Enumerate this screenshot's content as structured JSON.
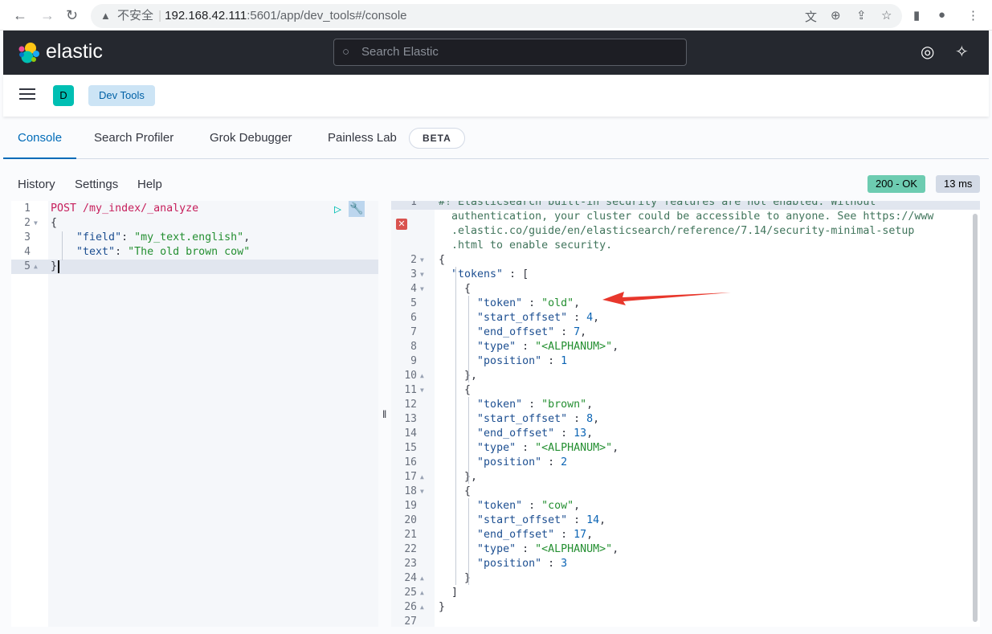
{
  "browser": {
    "security_label": "不安全",
    "url_host": "192.168.42.111",
    "url_path": ":5601/app/dev_tools#/console"
  },
  "header": {
    "brand": "elastic",
    "search_placeholder": "Search Elastic"
  },
  "breadcrumb": {
    "avatar": "D",
    "item": "Dev Tools"
  },
  "tabs": [
    {
      "label": "Console",
      "active": true
    },
    {
      "label": "Search Profiler"
    },
    {
      "label": "Grok Debugger"
    },
    {
      "label": "Painless Lab"
    }
  ],
  "beta_badge": "BETA",
  "toolbar": {
    "history": "History",
    "settings": "Settings",
    "help": "Help"
  },
  "response_status": {
    "status": "200 - OK",
    "status_color": "#6dccb1",
    "time": "13 ms"
  },
  "request_lines": [
    [
      [
        "m",
        "POST"
      ],
      [
        "p",
        " "
      ],
      [
        "u",
        "/my_index/_analyze"
      ]
    ],
    [
      [
        "p",
        "{"
      ]
    ],
    [
      [
        "p",
        "    "
      ],
      [
        "k",
        "\"field\""
      ],
      [
        "p",
        ": "
      ],
      [
        "s",
        "\"my_text.english\""
      ],
      [
        "p",
        ","
      ]
    ],
    [
      [
        "p",
        "    "
      ],
      [
        "k",
        "\"text\""
      ],
      [
        "p",
        ": "
      ],
      [
        "s",
        "\"The old brown cow\""
      ]
    ],
    [
      [
        "p",
        "}"
      ]
    ]
  ],
  "response_comment": [
    "#! Elasticsearch built-in security features are not enabled. Without",
    "  authentication, your cluster could be accessible to anyone. See https://www",
    "  .elastic.co/guide/en/elasticsearch/reference/7.14/security-minimal-setup",
    "  .html to enable security."
  ],
  "response_lines": [
    [
      [
        "p",
        "{"
      ]
    ],
    [
      [
        "p",
        "  "
      ],
      [
        "k",
        "\"tokens\""
      ],
      [
        "p",
        " : ["
      ]
    ],
    [
      [
        "p",
        "    {"
      ]
    ],
    [
      [
        "p",
        "      "
      ],
      [
        "k",
        "\"token\""
      ],
      [
        "p",
        " : "
      ],
      [
        "s",
        "\"old\""
      ],
      [
        "p",
        ","
      ]
    ],
    [
      [
        "p",
        "      "
      ],
      [
        "k",
        "\"start_offset\""
      ],
      [
        "p",
        " : "
      ],
      [
        "n",
        "4"
      ],
      [
        "p",
        ","
      ]
    ],
    [
      [
        "p",
        "      "
      ],
      [
        "k",
        "\"end_offset\""
      ],
      [
        "p",
        " : "
      ],
      [
        "n",
        "7"
      ],
      [
        "p",
        ","
      ]
    ],
    [
      [
        "p",
        "      "
      ],
      [
        "k",
        "\"type\""
      ],
      [
        "p",
        " : "
      ],
      [
        "s",
        "\"<ALPHANUM>\""
      ],
      [
        "p",
        ","
      ]
    ],
    [
      [
        "p",
        "      "
      ],
      [
        "k",
        "\"position\""
      ],
      [
        "p",
        " : "
      ],
      [
        "n",
        "1"
      ]
    ],
    [
      [
        "p",
        "    },"
      ]
    ],
    [
      [
        "p",
        "    {"
      ]
    ],
    [
      [
        "p",
        "      "
      ],
      [
        "k",
        "\"token\""
      ],
      [
        "p",
        " : "
      ],
      [
        "s",
        "\"brown\""
      ],
      [
        "p",
        ","
      ]
    ],
    [
      [
        "p",
        "      "
      ],
      [
        "k",
        "\"start_offset\""
      ],
      [
        "p",
        " : "
      ],
      [
        "n",
        "8"
      ],
      [
        "p",
        ","
      ]
    ],
    [
      [
        "p",
        "      "
      ],
      [
        "k",
        "\"end_offset\""
      ],
      [
        "p",
        " : "
      ],
      [
        "n",
        "13"
      ],
      [
        "p",
        ","
      ]
    ],
    [
      [
        "p",
        "      "
      ],
      [
        "k",
        "\"type\""
      ],
      [
        "p",
        " : "
      ],
      [
        "s",
        "\"<ALPHANUM>\""
      ],
      [
        "p",
        ","
      ]
    ],
    [
      [
        "p",
        "      "
      ],
      [
        "k",
        "\"position\""
      ],
      [
        "p",
        " : "
      ],
      [
        "n",
        "2"
      ]
    ],
    [
      [
        "p",
        "    },"
      ]
    ],
    [
      [
        "p",
        "    {"
      ]
    ],
    [
      [
        "p",
        "      "
      ],
      [
        "k",
        "\"token\""
      ],
      [
        "p",
        " : "
      ],
      [
        "s",
        "\"cow\""
      ],
      [
        "p",
        ","
      ]
    ],
    [
      [
        "p",
        "      "
      ],
      [
        "k",
        "\"start_offset\""
      ],
      [
        "p",
        " : "
      ],
      [
        "n",
        "14"
      ],
      [
        "p",
        ","
      ]
    ],
    [
      [
        "p",
        "      "
      ],
      [
        "k",
        "\"end_offset\""
      ],
      [
        "p",
        " : "
      ],
      [
        "n",
        "17"
      ],
      [
        "p",
        ","
      ]
    ],
    [
      [
        "p",
        "      "
      ],
      [
        "k",
        "\"type\""
      ],
      [
        "p",
        " : "
      ],
      [
        "s",
        "\"<ALPHANUM>\""
      ],
      [
        "p",
        ","
      ]
    ],
    [
      [
        "p",
        "      "
      ],
      [
        "k",
        "\"position\""
      ],
      [
        "p",
        " : "
      ],
      [
        "n",
        "3"
      ]
    ],
    [
      [
        "p",
        "    }"
      ]
    ],
    [
      [
        "p",
        "  ]"
      ]
    ],
    [
      [
        "p",
        "}"
      ]
    ],
    []
  ],
  "request_folds": {
    "2": "down",
    "5": "up"
  },
  "response_folds": {
    "2": "down",
    "3": "down",
    "4": "down",
    "10": "up",
    "11": "down",
    "17": "up",
    "18": "down",
    "24": "up",
    "25": "up",
    "26": "up"
  },
  "annotation": {
    "arrow_color": "#e8372c",
    "points_to": "\"token\" : \"old\""
  }
}
